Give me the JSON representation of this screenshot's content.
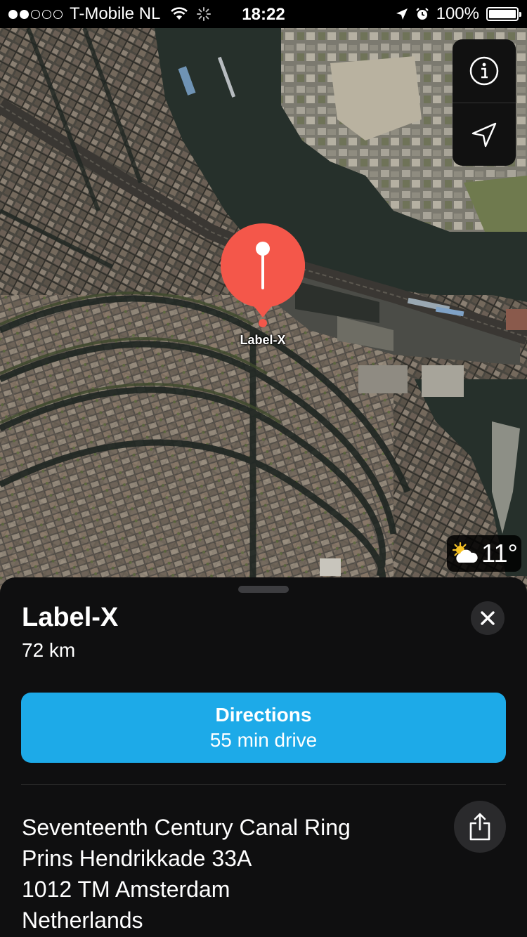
{
  "status_bar": {
    "signal_bars_filled": 2,
    "signal_bars_total": 5,
    "carrier": "T-Mobile NL",
    "time": "18:22",
    "battery": "100%",
    "icons": [
      "wifi-icon",
      "activity-spinner-icon",
      "location-arrow-icon",
      "alarm-icon",
      "battery-icon"
    ]
  },
  "map": {
    "controls": [
      {
        "name": "info",
        "icon": "info-icon"
      },
      {
        "name": "location",
        "icon": "location-arrow-icon"
      }
    ],
    "pin": {
      "label": "Label-X",
      "color": "#f4574a"
    },
    "weather": {
      "icon": "partly-cloudy-icon",
      "temperature": "11°"
    }
  },
  "sheet": {
    "title": "Label-X",
    "distance": "72 km",
    "directions": {
      "label": "Directions",
      "sublabel": "55 min drive",
      "color": "#1daae8"
    },
    "address": [
      "Seventeenth Century Canal Ring",
      "Prins Hendrikkade 33A",
      "1012 TM Amsterdam",
      "Netherlands"
    ]
  }
}
